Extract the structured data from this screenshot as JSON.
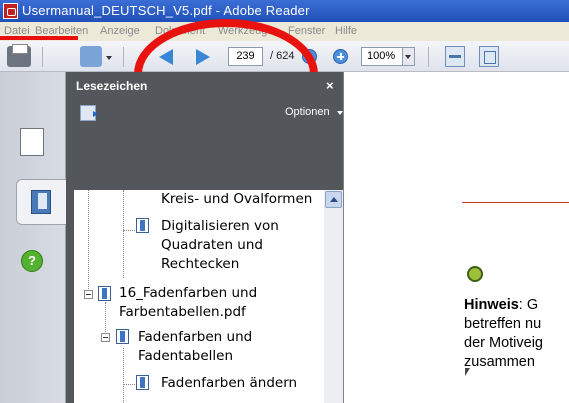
{
  "window": {
    "title": "Usermanual_DEUTSCH_V5.pdf - Adobe Reader"
  },
  "menu": [
    "Datei",
    "Bearbeiten",
    "Anzeige",
    "Dokument",
    "Werkzeuge",
    "Fenster",
    "Hilfe"
  ],
  "toolbar": {
    "current_page": "239",
    "page_total": "/ 624",
    "zoom": "100%"
  },
  "bookmarks_panel": {
    "title": "Lesezeichen",
    "close_label": "×",
    "options_label": "Optionen",
    "items": [
      {
        "label": "Kreis- und Ovalformen"
      },
      {
        "label_lines": [
          "Digitalisieren von",
          "Quadraten und",
          "Rechtecken"
        ]
      },
      {
        "label_lines": [
          "16_Fadenfarben und",
          "Farbentabellen.pdf"
        ]
      },
      {
        "label_lines": [
          "Fadenfarben und",
          "Fadentabellen"
        ]
      },
      {
        "label": "Fadenfarben ändern"
      }
    ]
  },
  "help_label": "?",
  "document": {
    "note_label": "Hinweis",
    "note_suffix": ": G",
    "lines": [
      "betreffen nu",
      "der Motiveig",
      "zusammen"
    ]
  }
}
